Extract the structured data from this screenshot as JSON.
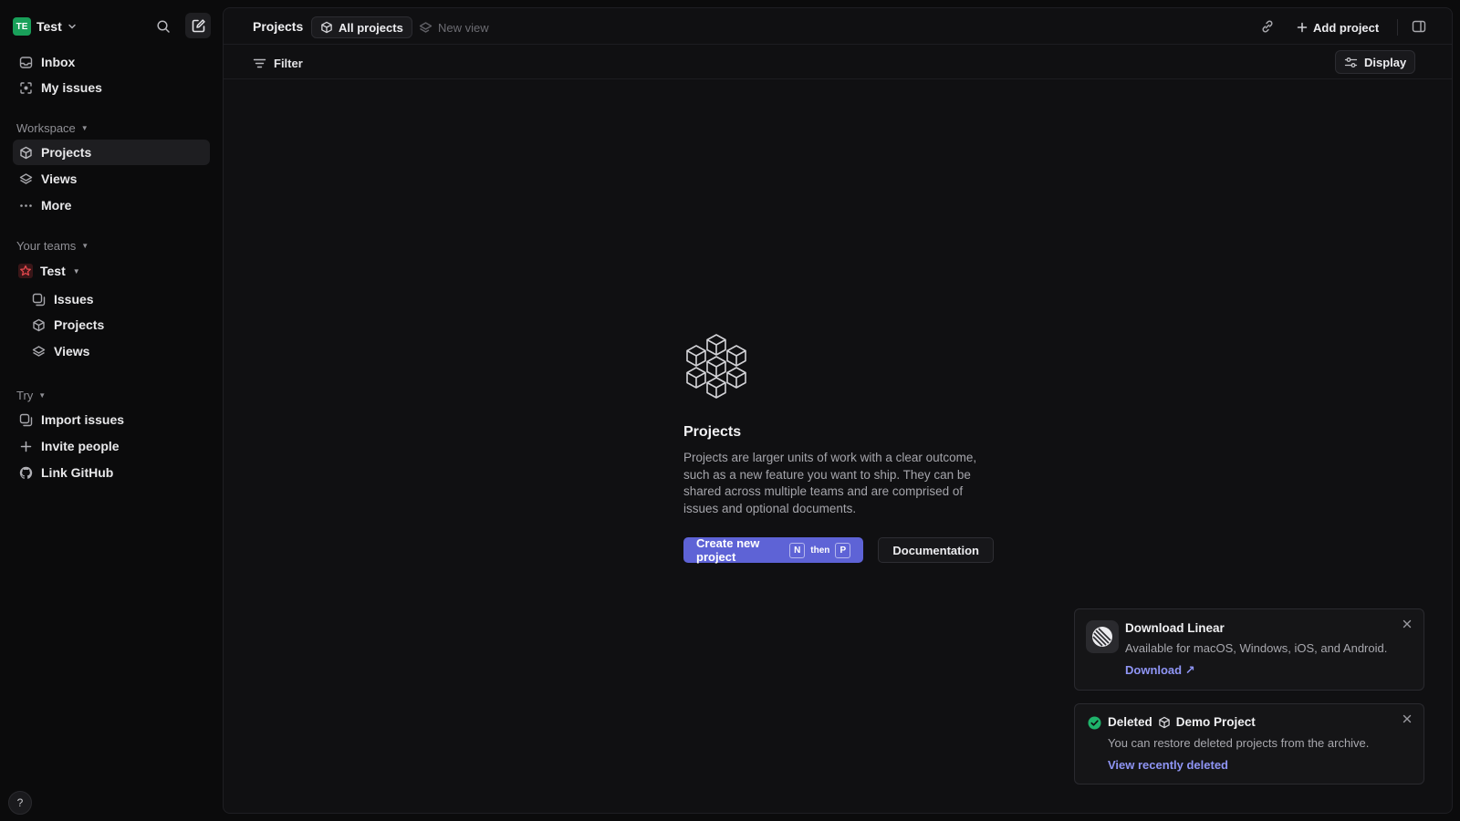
{
  "workspace": {
    "badge": "TE",
    "name": "Test"
  },
  "sidebar": {
    "primary": [
      {
        "label": "Inbox",
        "icon": "inbox-icon"
      },
      {
        "label": "My issues",
        "icon": "my-issues-icon"
      }
    ],
    "workspace_label": "Workspace",
    "workspace_items": [
      {
        "label": "Projects",
        "icon": "cube-icon",
        "active": true
      },
      {
        "label": "Views",
        "icon": "layers-icon"
      },
      {
        "label": "More",
        "icon": "more-icon"
      }
    ],
    "teams_label": "Your teams",
    "team": {
      "name": "Test",
      "icon": "star-team-icon"
    },
    "team_items": [
      {
        "label": "Issues",
        "icon": "issues-icon"
      },
      {
        "label": "Projects",
        "icon": "cube-icon"
      },
      {
        "label": "Views",
        "icon": "layers-icon"
      }
    ],
    "try_label": "Try",
    "try_items": [
      {
        "label": "Import issues",
        "icon": "import-icon"
      },
      {
        "label": "Invite people",
        "icon": "plus-icon"
      },
      {
        "label": "Link GitHub",
        "icon": "github-icon"
      }
    ],
    "help": "?"
  },
  "header": {
    "breadcrumb": "Projects",
    "active_tab": "All projects",
    "new_view": "New view",
    "add_project": "Add project"
  },
  "filterbar": {
    "filter": "Filter",
    "display": "Display"
  },
  "empty_state": {
    "title": "Projects",
    "description": "Projects are larger units of work with a clear outcome, such as a new feature you want to ship. They can be shared across multiple teams and are comprised of issues and optional documents.",
    "primary_button": "Create new project",
    "shortcut_key_1": "N",
    "shortcut_then": "then",
    "shortcut_key_2": "P",
    "secondary_button": "Documentation"
  },
  "toasts": {
    "download": {
      "title": "Download Linear",
      "body": "Available for macOS, Windows, iOS, and Android.",
      "link": "Download ↗"
    },
    "deleted": {
      "status": "Deleted",
      "project": "Demo Project",
      "body": "You can restore deleted projects from the archive.",
      "link": "View recently deleted"
    }
  },
  "colors": {
    "accent": "#5e63d6",
    "link": "#8f95f5",
    "success": "#1fb36b",
    "team_icon": "#e5484d",
    "workspace_badge": "#19a05a"
  }
}
